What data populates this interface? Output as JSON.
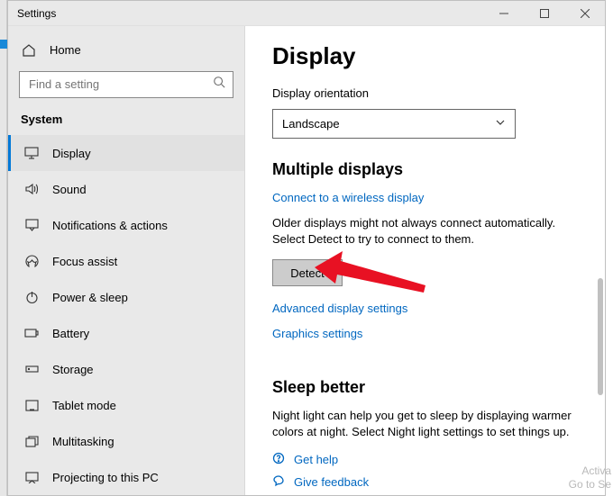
{
  "window": {
    "title": "Settings"
  },
  "sidebar": {
    "home": "Home",
    "search_placeholder": "Find a setting",
    "category": "System",
    "items": [
      {
        "label": "Display"
      },
      {
        "label": "Sound"
      },
      {
        "label": "Notifications & actions"
      },
      {
        "label": "Focus assist"
      },
      {
        "label": "Power & sleep"
      },
      {
        "label": "Battery"
      },
      {
        "label": "Storage"
      },
      {
        "label": "Tablet mode"
      },
      {
        "label": "Multitasking"
      },
      {
        "label": "Projecting to this PC"
      }
    ]
  },
  "main": {
    "heading": "Display",
    "orientation_label": "Display orientation",
    "orientation_value": "Landscape",
    "multi_heading": "Multiple displays",
    "connect_link": "Connect to a wireless display",
    "multi_para": "Older displays might not always connect automatically. Select Detect to try to connect to them.",
    "detect_button": "Detect",
    "adv_link": "Advanced display settings",
    "gfx_link": "Graphics settings",
    "sleep_heading": "Sleep better",
    "sleep_para": "Night light can help you get to sleep by displaying warmer colors at night. Select Night light settings to set things up.",
    "help_link": "Get help",
    "feedback_link": "Give feedback"
  },
  "watermark": {
    "line1": "Activa",
    "line2": "Go to Se"
  }
}
